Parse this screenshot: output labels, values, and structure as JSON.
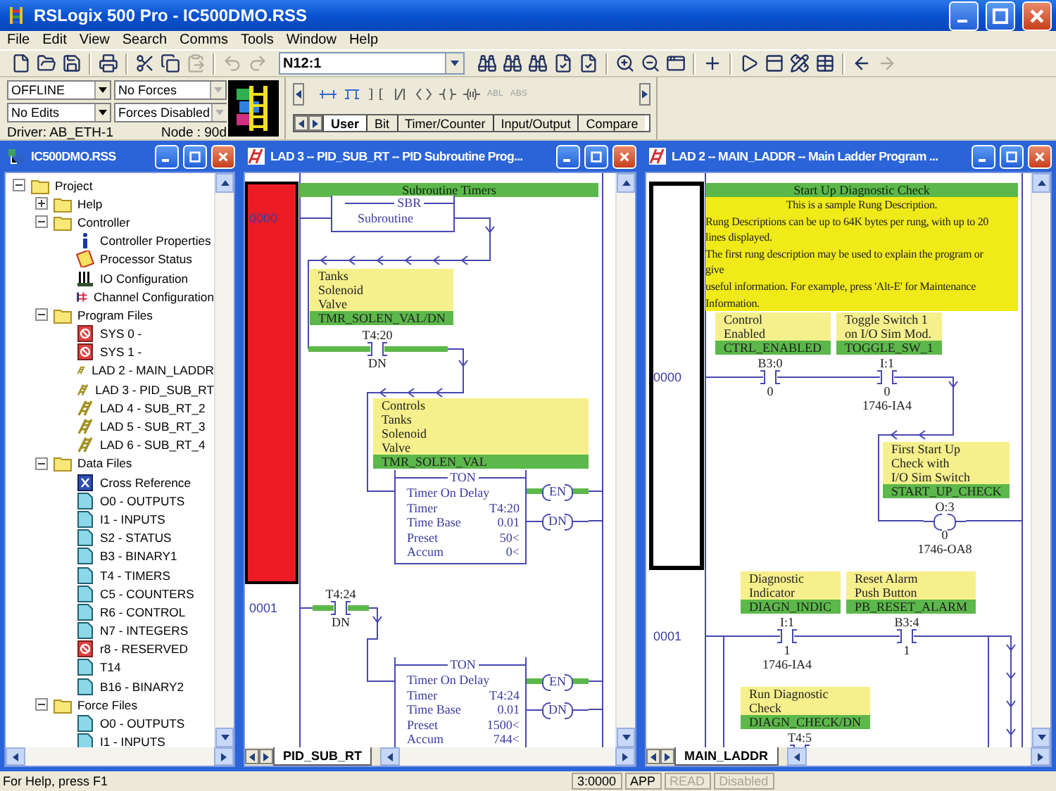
{
  "app_title": "RSLogix 500 Pro - IC500DMO.RSS",
  "menu": [
    "File",
    "Edit",
    "View",
    "Search",
    "Comms",
    "Tools",
    "Window",
    "Help"
  ],
  "toolbar": {
    "address": "N12:1",
    "undo_enabled": false,
    "redo_enabled": false,
    "paste_enabled": false,
    "forward_enabled": false
  },
  "status_panel": {
    "fields": [
      {
        "value": "OFFLINE",
        "disabled": false
      },
      {
        "value": "No Forces",
        "disabled": true
      },
      {
        "value": "No Edits",
        "disabled": false
      },
      {
        "value": "Forces Disabled",
        "disabled": true
      }
    ],
    "driver": "Driver: AB_ETH-1",
    "node": "Node : 90d"
  },
  "palette": {
    "text_buttons": [
      "ABL",
      "ABS"
    ],
    "tabs": [
      {
        "label": "User",
        "selected": true
      },
      {
        "label": "Bit",
        "selected": false
      },
      {
        "label": "Timer/Counter",
        "selected": false
      },
      {
        "label": "Input/Output",
        "selected": false
      },
      {
        "label": "Compare",
        "selected": false
      }
    ]
  },
  "project_tree": {
    "title": "IC500DMO.RSS",
    "items": [
      {
        "label": "Project",
        "kind": "folder",
        "expanded": true,
        "children": [
          {
            "label": "Help",
            "kind": "folder",
            "expanded": false
          },
          {
            "label": "Controller",
            "kind": "folder",
            "expanded": true,
            "children": [
              {
                "label": "Controller Properties",
                "kind": "info"
              },
              {
                "label": "Processor Status",
                "kind": "status"
              },
              {
                "label": "IO Configuration",
                "kind": "io"
              },
              {
                "label": "Channel Configuration",
                "kind": "channel"
              }
            ]
          },
          {
            "label": "Program Files",
            "kind": "folder",
            "expanded": true,
            "children": [
              {
                "label": "SYS 0 -",
                "kind": "system"
              },
              {
                "label": "SYS 1 -",
                "kind": "system"
              },
              {
                "label": "LAD 2 - MAIN_LADDR",
                "kind": "ladder"
              },
              {
                "label": "LAD 3 - PID_SUB_RT",
                "kind": "ladder"
              },
              {
                "label": "LAD 4 - SUB_RT_2",
                "kind": "ladder"
              },
              {
                "label": "LAD 5 - SUB_RT_3",
                "kind": "ladder"
              },
              {
                "label": "LAD 6 - SUB_RT_4",
                "kind": "ladder"
              }
            ]
          },
          {
            "label": "Data Files",
            "kind": "folder",
            "expanded": true,
            "children": [
              {
                "label": "Cross Reference",
                "kind": "xref"
              },
              {
                "label": "O0 - OUTPUTS",
                "kind": "data"
              },
              {
                "label": "I1 - INPUTS",
                "kind": "data"
              },
              {
                "label": "S2 - STATUS",
                "kind": "data"
              },
              {
                "label": "B3 - BINARY1",
                "kind": "data"
              },
              {
                "label": "T4 - TIMERS",
                "kind": "data"
              },
              {
                "label": "C5 - COUNTERS",
                "kind": "data"
              },
              {
                "label": "R6 - CONTROL",
                "kind": "data"
              },
              {
                "label": "N7 - INTEGERS",
                "kind": "data"
              },
              {
                "label": "r8 - RESERVED",
                "kind": "system"
              },
              {
                "label": "T14",
                "kind": "data"
              },
              {
                "label": "B16 - BINARY2",
                "kind": "data"
              }
            ]
          },
          {
            "label": "Force Files",
            "kind": "folder",
            "expanded": true,
            "children": [
              {
                "label": "O0 - OUTPUTS",
                "kind": "data"
              },
              {
                "label": "I1 - INPUTS",
                "kind": "data"
              }
            ]
          }
        ]
      }
    ]
  },
  "ladders": [
    {
      "title": "LAD 3 -- PID_SUB_RT -- PID Subroutine Prog...",
      "sheet_tab": "PID_SUB_RT",
      "header": "Subroutine Timers",
      "color": "#ed1c24",
      "rungs": [
        {
          "number": "0000",
          "selected": true
        },
        {
          "number": "0001",
          "selected": false
        }
      ],
      "elements": [
        {
          "kind": "instruction",
          "title": "SBR",
          "label": "Subroutine"
        },
        {
          "kind": "comment",
          "lines": [
            "Tanks",
            "Solenoid",
            "Valve"
          ],
          "tag": "TMR_SOLEN_VAL/DN"
        },
        {
          "kind": "contact",
          "address": "T4:20",
          "bit": "DN",
          "energized": true
        },
        {
          "kind": "comment",
          "lines": [
            "Controls",
            "Tanks",
            "Solenoid",
            "Valve"
          ],
          "tag": "TMR_SOLEN_VAL"
        },
        {
          "kind": "timer",
          "title": "TON",
          "rows": [
            {
              "label": "Timer On Delay"
            },
            {
              "label": "Timer",
              "value": "T4:20"
            },
            {
              "label": "Time Base",
              "value": "0.01"
            },
            {
              "label": "Preset",
              "value": "50<"
            },
            {
              "label": "Accum",
              "value": "0<"
            }
          ]
        },
        {
          "kind": "coil",
          "label": "EN",
          "energized": true
        },
        {
          "kind": "coil",
          "label": "DN",
          "energized": false
        },
        {
          "kind": "contact",
          "address": "T4:24",
          "bit": "DN",
          "energized": true
        },
        {
          "kind": "timer",
          "title": "TON",
          "rows": [
            {
              "label": "Timer On Delay"
            },
            {
              "label": "Timer",
              "value": "T4:24"
            },
            {
              "label": "Time Base",
              "value": "0.01"
            },
            {
              "label": "Preset",
              "value": "1500<"
            },
            {
              "label": "Accum",
              "value": "744<"
            }
          ]
        },
        {
          "kind": "coil",
          "label": "EN",
          "energized": true
        },
        {
          "kind": "coil",
          "label": "DN",
          "energized": false
        }
      ]
    },
    {
      "title": "LAD 2 -- MAIN_LADDR -- Main Ladder Program ...",
      "sheet_tab": "MAIN_LADDR",
      "header": "Start Up Diagnostic Check",
      "color": "#ffffff",
      "description": [
        "This is a sample Rung Description.",
        "Rung Descriptions can be up to 64K bytes per rung, with up to 20",
        "lines displayed.",
        "The first rung description may be used to explain the program or",
        "give",
        "useful information.  For example, press 'Alt-E' for Maintenance",
        "Information."
      ],
      "rungs": [
        {
          "number": "0000",
          "selected": true
        },
        {
          "number": "0001",
          "selected": false
        }
      ],
      "elements": [
        {
          "kind": "comment",
          "lines": [
            "Control",
            "Enabled"
          ],
          "tag": "CTRL_ENABLED"
        },
        {
          "kind": "comment",
          "lines": [
            "Toggle Switch 1",
            "on I/O Sim Mod."
          ],
          "tag": "TOGGLE_SW_1"
        },
        {
          "kind": "contact",
          "address": "B3:0",
          "bit": "0",
          "energized": false
        },
        {
          "kind": "contact",
          "address": "I:1",
          "bit": "0",
          "module": "1746-IA4",
          "energized": false
        },
        {
          "kind": "comment",
          "lines": [
            "First Start Up",
            "Check with",
            "I/O Sim Switch"
          ],
          "tag": "START_UP_CHECK"
        },
        {
          "kind": "coil",
          "address": "O:3",
          "bit": "0",
          "module": "1746-OA8",
          "energized": false
        },
        {
          "kind": "comment",
          "lines": [
            "Diagnostic",
            "Indicator"
          ],
          "tag": "DIAGN_INDIC"
        },
        {
          "kind": "comment",
          "lines": [
            "Reset Alarm",
            "Push Button"
          ],
          "tag": "PB_RESET_ALARM"
        },
        {
          "kind": "contact",
          "address": "I:1",
          "bit": "1",
          "module": "1746-IA4",
          "energized": false
        },
        {
          "kind": "contact",
          "address": "B3:4",
          "bit": "1",
          "energized": false
        },
        {
          "kind": "comment",
          "lines": [
            "Run Diagnostic",
            "Check"
          ],
          "tag": "DIAGN_CHECK/DN"
        },
        {
          "kind": "contact",
          "address": "T4:5"
        }
      ]
    }
  ],
  "status_bar": {
    "message": "For Help, press F1",
    "panes": [
      {
        "text": "3:0000",
        "disabled": false
      },
      {
        "text": "APP",
        "disabled": false
      },
      {
        "text": "READ",
        "disabled": true
      },
      {
        "text": "Disabled",
        "disabled": true
      }
    ]
  }
}
